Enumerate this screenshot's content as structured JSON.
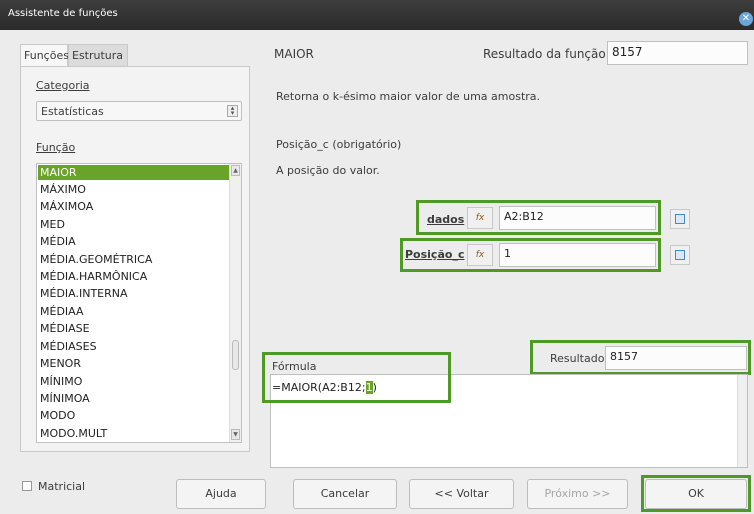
{
  "window": {
    "title": "Assistente de funções",
    "close_icon": "close-icon"
  },
  "tabs": [
    {
      "label": "Funções"
    },
    {
      "label": "Estrutura"
    }
  ],
  "left": {
    "category_label": "Categoria",
    "category_value": "Estatísticas",
    "function_label": "Função",
    "functions": [
      "MAIOR",
      "MÁXIMO",
      "MÁXIMOA",
      "MED",
      "MÉDIA",
      "MÉDIA.GEOMÉTRICA",
      "MÉDIA.HARMÔNICA",
      "MÉDIA.INTERNA",
      "MÉDIAA",
      "MÉDIASE",
      "MÉDIASES",
      "MENOR",
      "MÍNIMO",
      "MÍNIMOA",
      "MODO",
      "MODO.MULT"
    ],
    "selected_index": 0
  },
  "right": {
    "function_name": "MAIOR",
    "result_label": "Resultado da função",
    "result_value": "8157",
    "description": "Retorna o k-ésimo maior valor de uma amostra.",
    "param_title": "Posição_c (obrigatório)",
    "param_description": "A posição do valor.",
    "args": [
      {
        "label": "dados",
        "value": "A2:B12",
        "fx": "fx"
      },
      {
        "label": "Posição_c",
        "value": "1",
        "fx": "fx"
      }
    ],
    "formula_label": "Fórmula",
    "resultado_label": "Resultado",
    "resultado_value": "8157",
    "formula_value": "=MAIOR(A2:B12;",
    "formula_highlight": "1",
    "formula_tail": ")"
  },
  "bottom": {
    "matricial_label": "Matricial",
    "help": "Ajuda",
    "cancel": "Cancelar",
    "back": "<< Voltar",
    "next": "Próximo >>",
    "ok": "OK"
  },
  "colors": {
    "accent": "#4f9a25",
    "selection": "#6aa329",
    "titlebar": "#2b2b2b"
  }
}
